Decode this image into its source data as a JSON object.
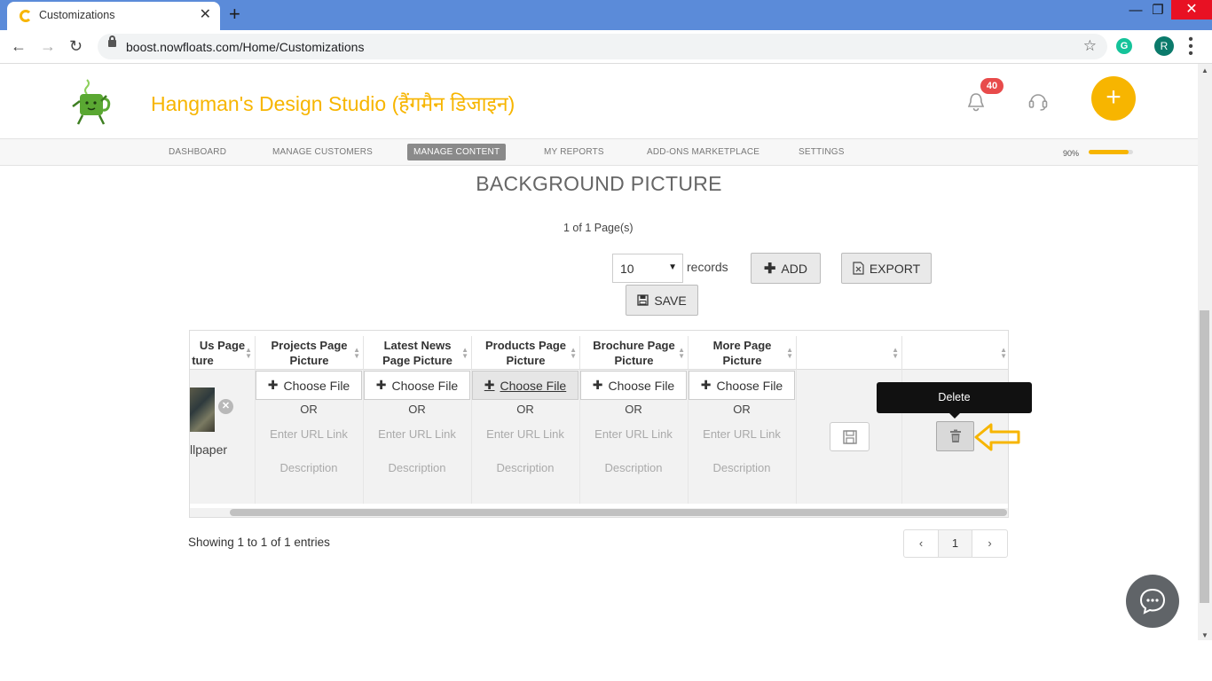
{
  "browser": {
    "tab_title": "Customizations",
    "tab_close": "✕",
    "new_tab": "+",
    "url": "boost.nowfloats.com/Home/Customizations",
    "profile_initial": "R",
    "grammarly_initial": "G"
  },
  "header": {
    "brand": "Hangman's Design Studio (हैंगमैन डिजाइन)",
    "notification_count": "40",
    "add_button": "+"
  },
  "nav": {
    "items": [
      "DASHBOARD",
      "MANAGE CUSTOMERS",
      "MANAGE CONTENT",
      "MY REPORTS",
      "ADD-ONS MARKETPLACE",
      "SETTINGS"
    ],
    "active": "MANAGE CONTENT",
    "progress_label": "90%",
    "progress_value": 0.9
  },
  "content": {
    "title": "BACKGROUND PICTURE",
    "page_info": "1 of 1 Page(s)",
    "records_value": "10",
    "records_label": "records",
    "add_label": "ADD",
    "export_label": "EXPORT",
    "save_label": "SAVE"
  },
  "table": {
    "headers": [
      [
        "Us Page",
        "ture"
      ],
      [
        "Projects Page",
        "Picture"
      ],
      [
        "Latest News",
        "Page Picture"
      ],
      [
        "Products Page",
        "Picture"
      ],
      [
        "Brochure Page",
        "Picture"
      ],
      [
        "More Page",
        "Picture"
      ]
    ],
    "partial_cell_label": "llpaper",
    "choose_file": "Choose File",
    "or": "OR",
    "url_placeholder": "Enter URL Link",
    "description_placeholder": "Description",
    "tooltip": "Delete"
  },
  "footer": {
    "entries_info": "Showing 1 to 1 of 1 entries",
    "prev": "‹",
    "current_page": "1",
    "next": "›"
  },
  "colors": {
    "brand": "#f7b500",
    "tabbar": "#5b8bd9",
    "badge": "#e84b4b"
  }
}
